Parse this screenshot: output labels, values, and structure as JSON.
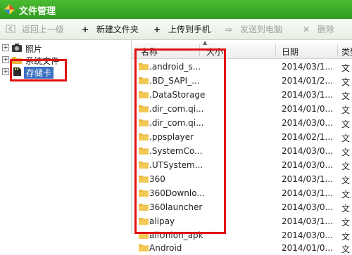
{
  "window": {
    "title": "文件管理"
  },
  "toolbar": {
    "back": {
      "label": "返回上一级",
      "icon": "back-arrow-icon"
    },
    "new_folder": {
      "label": "新建文件夹",
      "icon": "plus-icon"
    },
    "upload": {
      "label": "上传到手机",
      "icon": "plus-icon"
    },
    "send_pc": {
      "label": "发送到电脑",
      "icon": "send-to-pc-icon"
    },
    "delete": {
      "label": "删除",
      "icon": "close-icon"
    }
  },
  "tree": {
    "items": [
      {
        "label": "照片",
        "icon": "camera-icon",
        "expander": "+"
      },
      {
        "label": "系统文件",
        "icon": "folder-icon",
        "expander": "+"
      },
      {
        "label": "存储卡",
        "icon": "sd-card-icon",
        "expander": "+",
        "selected": true
      }
    ]
  },
  "list": {
    "columns": {
      "name": "名称",
      "size": "大小",
      "date": "日期",
      "type": "类型"
    },
    "rows": [
      {
        "name": ".android_s...",
        "date": "2014/03/1...",
        "type": "文"
      },
      {
        "name": ".BD_SAPI_...",
        "date": "2014/01/2...",
        "type": "文"
      },
      {
        "name": ".DataStorage",
        "date": "2014/03/1...",
        "type": "文"
      },
      {
        "name": ".dir_com.qi...",
        "date": "2014/01/0...",
        "type": "文"
      },
      {
        "name": ".dir_com.qi...",
        "date": "2014/03/0...",
        "type": "文"
      },
      {
        "name": ".ppsplayer",
        "date": "2014/02/1...",
        "type": "文"
      },
      {
        "name": ".SystemCo...",
        "date": "2014/03/0...",
        "type": "文"
      },
      {
        "name": ".UTSystem...",
        "date": "2014/03/0...",
        "type": "文"
      },
      {
        "name": "360",
        "date": "2014/03/1...",
        "type": "文"
      },
      {
        "name": "360Downlo...",
        "date": "2014/03/1...",
        "type": "文"
      },
      {
        "name": "360launcher",
        "date": "2014/03/0...",
        "type": "文"
      },
      {
        "name": "alipay",
        "date": "2014/03/1...",
        "type": "文"
      },
      {
        "name": "allUnion_apk",
        "date": "2014/03/0...",
        "type": "文"
      },
      {
        "name": "Android",
        "date": "2014/01/0...",
        "type": "文"
      }
    ]
  },
  "colors": {
    "titlebar": "#3aa825",
    "selection": "#3a6fc2",
    "highlight_box": "#e01010",
    "folder": "#e8b23a"
  }
}
